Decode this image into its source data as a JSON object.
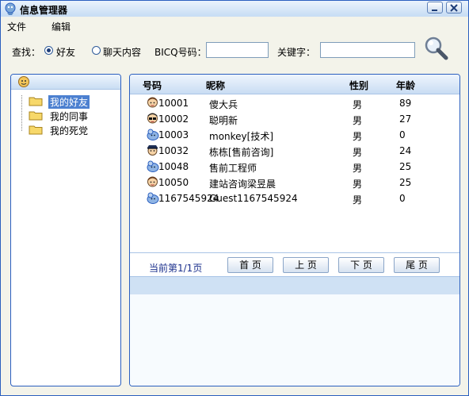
{
  "window": {
    "title": "信息管理器"
  },
  "menu": {
    "file": "文件",
    "edit": "编辑"
  },
  "search": {
    "label": "查找：",
    "option_friend": "好友",
    "option_chat": "聊天内容",
    "bicq_label": "BICQ号码：",
    "bicq_value": "",
    "keyword_label": "关键字：",
    "keyword_value": ""
  },
  "tree": {
    "items": [
      {
        "label": "我的好友",
        "selected": true
      },
      {
        "label": "我的同事",
        "selected": false
      },
      {
        "label": "我的死党",
        "selected": false
      }
    ]
  },
  "table": {
    "headers": {
      "id": "号码",
      "nick": "昵称",
      "gender": "性别",
      "age": "年龄"
    },
    "rows": [
      {
        "id": "10001",
        "nick": "傻大兵",
        "gender": "男",
        "age": "89",
        "avatar": "boy-avatar-icon"
      },
      {
        "id": "10002",
        "nick": "聪明新",
        "gender": "男",
        "age": "27",
        "avatar": "glasses-avatar-icon"
      },
      {
        "id": "10003",
        "nick": "monkey[技术]",
        "gender": "男",
        "age": "0",
        "avatar": "guest-avatar-icon"
      },
      {
        "id": "10032",
        "nick": "栋栋[售前咨询]",
        "gender": "男",
        "age": "24",
        "avatar": "police-avatar-icon"
      },
      {
        "id": "10048",
        "nick": "售前工程师",
        "gender": "男",
        "age": "25",
        "avatar": "guest-avatar-icon"
      },
      {
        "id": "10050",
        "nick": "建站咨询梁昱晨",
        "gender": "男",
        "age": "25",
        "avatar": "boy-avatar-icon"
      },
      {
        "id": "1167545924",
        "nick": "Guest1167545924",
        "gender": "男",
        "age": "0",
        "avatar": "guest-avatar-icon"
      }
    ]
  },
  "pager": {
    "info": "当前第1/1页",
    "first": "首 页",
    "prev": "上 页",
    "next": "下 页",
    "last": "尾 页"
  }
}
